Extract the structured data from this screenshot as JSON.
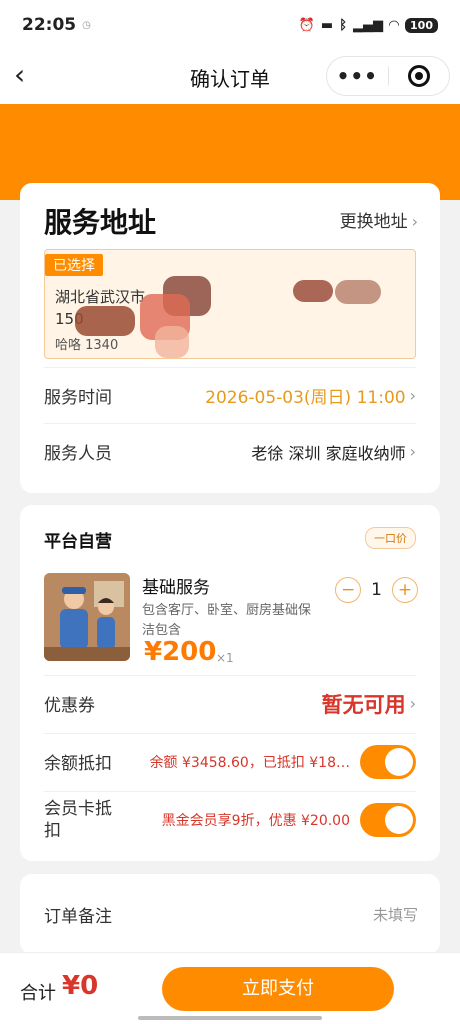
{
  "status": {
    "time": "22:05",
    "battery": "100"
  },
  "nav": {
    "title": "确认订单",
    "more": "•••"
  },
  "address": {
    "heading": "服务地址",
    "change_label": "更换地址",
    "selected_tag": "已选择",
    "line1": "湖北省武汉市",
    "line2": "150",
    "line3": "哈咯 1340"
  },
  "service_time": {
    "label": "服务时间",
    "value": "2026-05-03(周日) 11:00"
  },
  "staff": {
    "label": "服务人员",
    "value": "老徐 深圳 家庭收纳师"
  },
  "order": {
    "platform": "平台自营",
    "badge": "一口价",
    "item_name": "基础服务",
    "item_desc": "包含客厅、卧室、厨房基础保洁包含",
    "price": "¥200",
    "qty_suffix": "×1",
    "minus": "−",
    "qty": "1",
    "plus": "+"
  },
  "coupon": {
    "label": "优惠券",
    "value": "暂无可用"
  },
  "balance": {
    "label": "余额抵扣",
    "text": "余额 ¥3458.60，已抵扣 ¥18…"
  },
  "member": {
    "label": "会员卡抵扣",
    "text": "黑金会员享9折，优惠 ¥20.00"
  },
  "note": {
    "label": "订单备注",
    "value": "未填写"
  },
  "footer": {
    "total_label": "合计",
    "total": "¥0",
    "pay_label": "立即支付"
  },
  "colors": {
    "accent": "#ff8c00",
    "price": "#d8362a",
    "time": "#e89a1b"
  }
}
